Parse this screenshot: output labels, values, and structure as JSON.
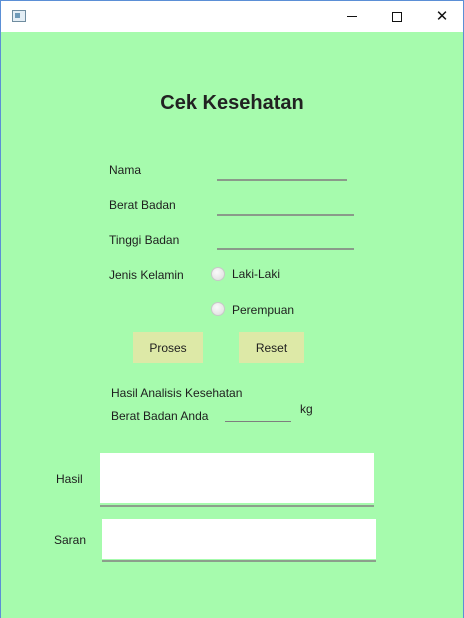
{
  "window": {
    "app_icon": "window-app-icon",
    "minimize_icon": "minimize-icon",
    "maximize_icon": "maximize-icon",
    "close_icon": "close-icon"
  },
  "form": {
    "title": "Cek Kesehatan",
    "nama_label": "Nama",
    "nama_value": "",
    "berat_label": "Berat Badan",
    "berat_value": "",
    "tinggi_label": "Tinggi Badan",
    "tinggi_value": "",
    "gender_label": "Jenis Kelamin",
    "gender_options": [
      "Laki-Laki",
      "Perempuan"
    ],
    "proses_label": "Proses",
    "reset_label": "Reset",
    "hasil_analisis_label": "Hasil Analisis Kesehatan",
    "berat_anda_label": "Berat Badan Anda",
    "berat_anda_value": "",
    "kg_unit": "kg",
    "hasil_label": "Hasil",
    "hasil_value": "",
    "saran_label": "Saran",
    "saran_value": ""
  },
  "colors": {
    "background": "#a6fbad",
    "button": "#dde9a7",
    "window_border": "#5b8fd6"
  }
}
